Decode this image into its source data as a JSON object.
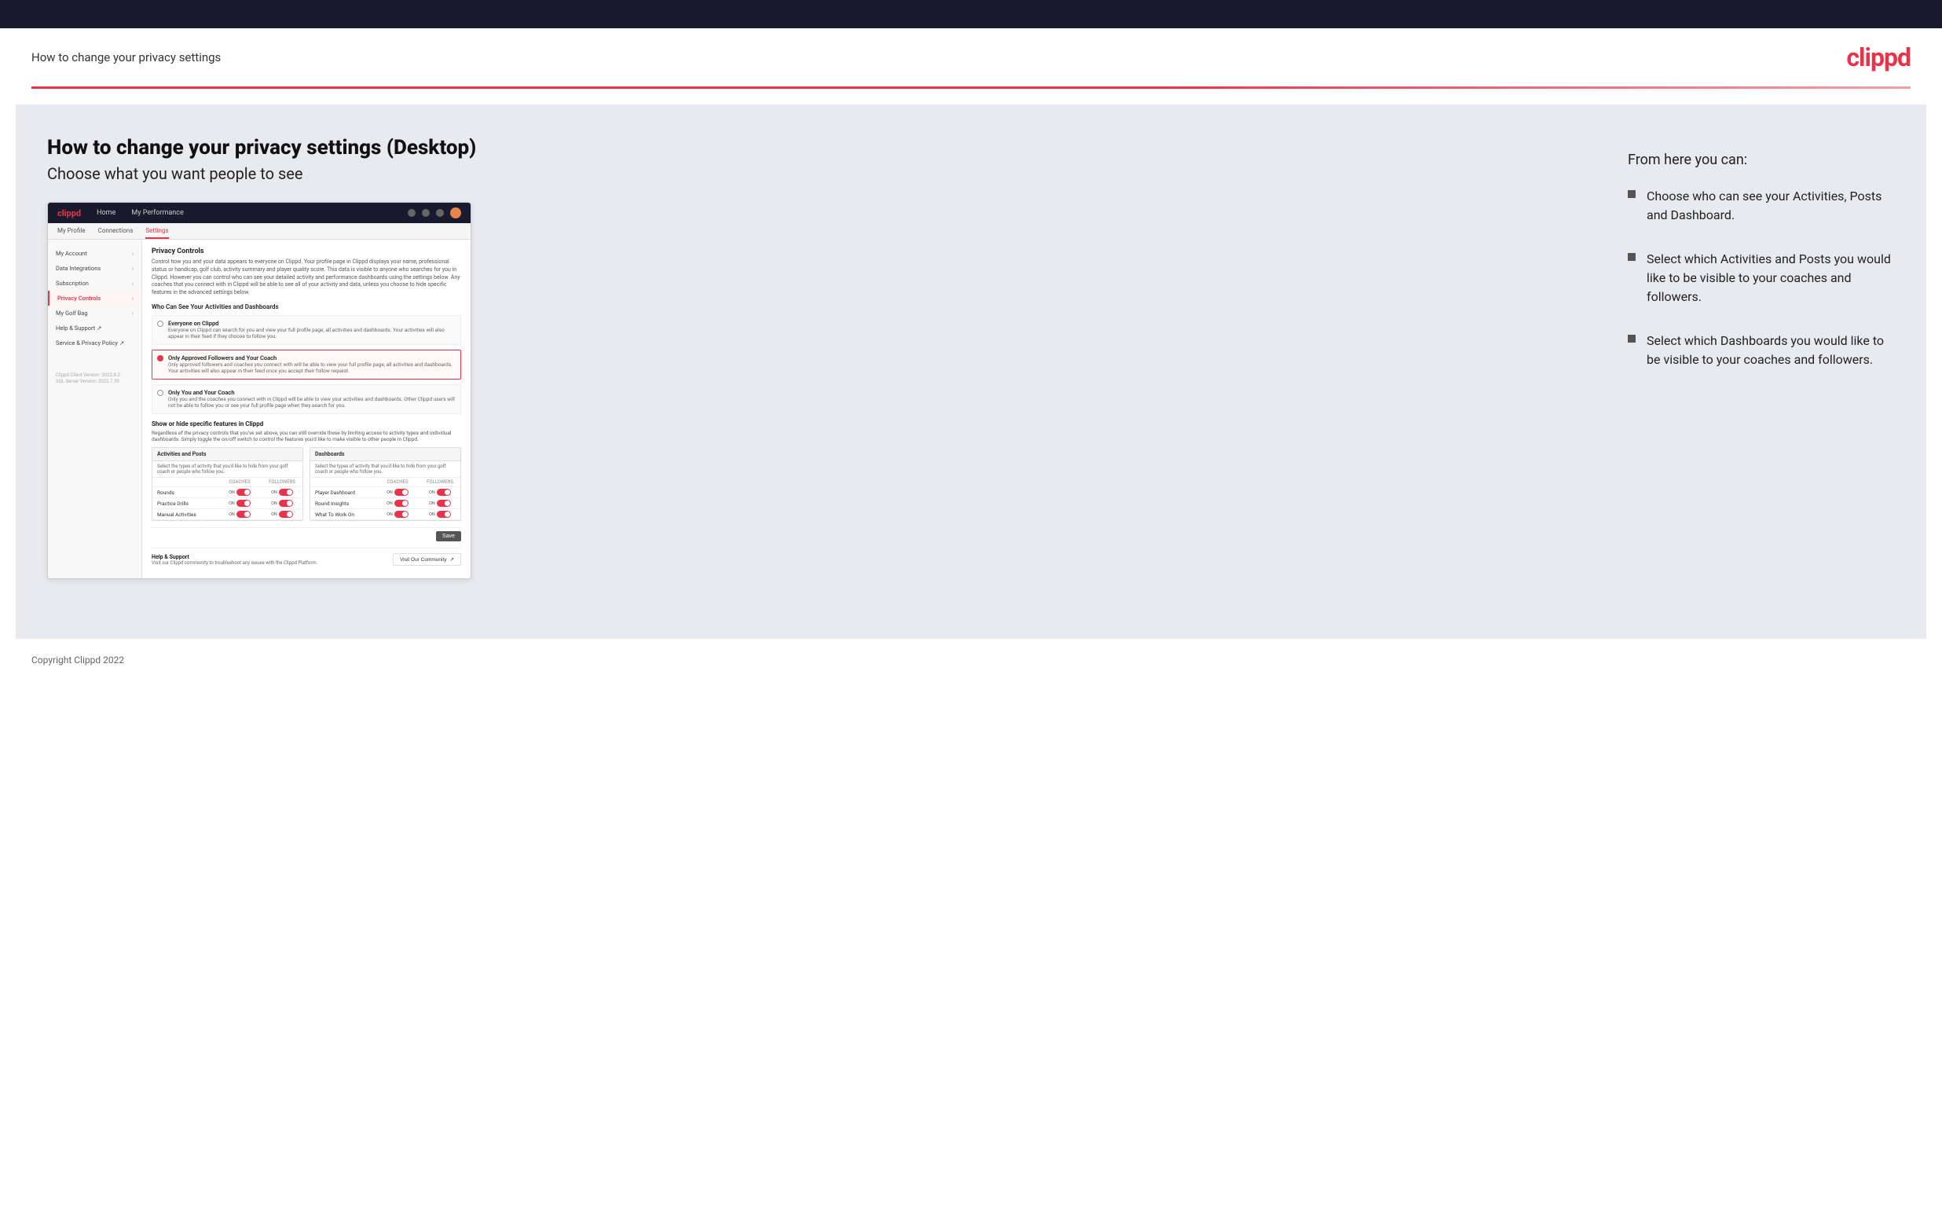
{
  "header": {
    "title": "How to change your privacy settings",
    "logo": "clippd"
  },
  "page": {
    "heading": "How to change your privacy settings (Desktop)",
    "subheading": "Choose what you want people to see"
  },
  "mockup": {
    "nav": {
      "logo": "clippd",
      "items": [
        "Home",
        "My Performance"
      ]
    },
    "tabs": [
      "My Profile",
      "Connections",
      "Settings"
    ],
    "active_tab": "Settings",
    "sidebar": {
      "items": [
        {
          "label": "My Account",
          "active": false
        },
        {
          "label": "Data Integrations",
          "active": false
        },
        {
          "label": "Subscription",
          "active": false
        },
        {
          "label": "Privacy Controls",
          "active": true
        },
        {
          "label": "My Golf Bag",
          "active": false
        },
        {
          "label": "Help & Support",
          "active": false,
          "external": true
        },
        {
          "label": "Service & Privacy Policy",
          "active": false,
          "external": true
        }
      ],
      "version": "Clippd Client Version: 2022.8.2\nSQL Server Version: 2022.7.39"
    },
    "main": {
      "section_title": "Privacy Controls",
      "section_desc": "Control how you and your data appears to everyone on Clippd. Your profile page in Clippd displays your name, professional status or handicap, golf club, activity summary and player quality score. This data is visible to anyone who searches for you in Clippd. However you can control who can see your detailed activity and performance dashboards using the settings below. Any coaches that you connect with in Clippd will be able to see all of your activity and data, unless you choose to hide specific features in the advanced settings below.",
      "who_can_see_title": "Who Can See Your Activities and Dashboards",
      "radio_options": [
        {
          "label": "Everyone on Clippd",
          "desc": "Everyone on Clippd can search for you and view your full profile page, all activities and dashboards. Your activities will also appear in their feed if they choose to follow you.",
          "selected": false
        },
        {
          "label": "Only Approved Followers and Your Coach",
          "desc": "Only approved followers and coaches you connect with will be able to view your full profile page, all activities and dashboards. Your activities will also appear in their feed once you accept their follow request.",
          "selected": true
        },
        {
          "label": "Only You and Your Coach",
          "desc": "Only you and the coaches you connect with in Clippd will be able to view your activities and dashboards. Other Clippd users will not be able to follow you or see your full profile page when they search for you.",
          "selected": false
        }
      ],
      "showhide_title": "Show or hide specific features in Clippd",
      "showhide_desc": "Regardless of the privacy controls that you've set above, you can still override these by limiting access to activity types and individual dashboards. Simply toggle the on/off switch to control the features you'd like to make visible to other people in Clippd.",
      "activities_table": {
        "title": "Activities and Posts",
        "desc": "Select the types of activity that you'd like to hide from your golf coach or people who follow you.",
        "cols": [
          "COACHES",
          "FOLLOWERS"
        ],
        "rows": [
          {
            "label": "Rounds",
            "coaches": "ON",
            "followers": "ON"
          },
          {
            "label": "Practice Drills",
            "coaches": "ON",
            "followers": "ON"
          },
          {
            "label": "Manual Activities",
            "coaches": "ON",
            "followers": "ON"
          }
        ]
      },
      "dashboards_table": {
        "title": "Dashboards",
        "desc": "Select the types of activity that you'd like to hide from your golf coach or people who follow you.",
        "cols": [
          "COACHES",
          "FOLLOWERS"
        ],
        "rows": [
          {
            "label": "Player Dashboard",
            "coaches": "ON",
            "followers": "ON"
          },
          {
            "label": "Round Insights",
            "coaches": "ON",
            "followers": "ON"
          },
          {
            "label": "What To Work On",
            "coaches": "ON",
            "followers": "ON"
          }
        ]
      },
      "save_label": "Save",
      "help_title": "Help & Support",
      "help_desc": "Visit our Clippd community to troubleshoot any issues with the Clippd Platform.",
      "help_btn": "Visit Our Community"
    }
  },
  "right_panel": {
    "from_here_title": "From here you can:",
    "bullets": [
      "Choose who can see your Activities, Posts and Dashboard.",
      "Select which Activities and Posts you would like to be visible to your coaches and followers.",
      "Select which Dashboards you would like to be visible to your coaches and followers."
    ]
  },
  "footer": {
    "text": "Copyright Clippd 2022"
  }
}
